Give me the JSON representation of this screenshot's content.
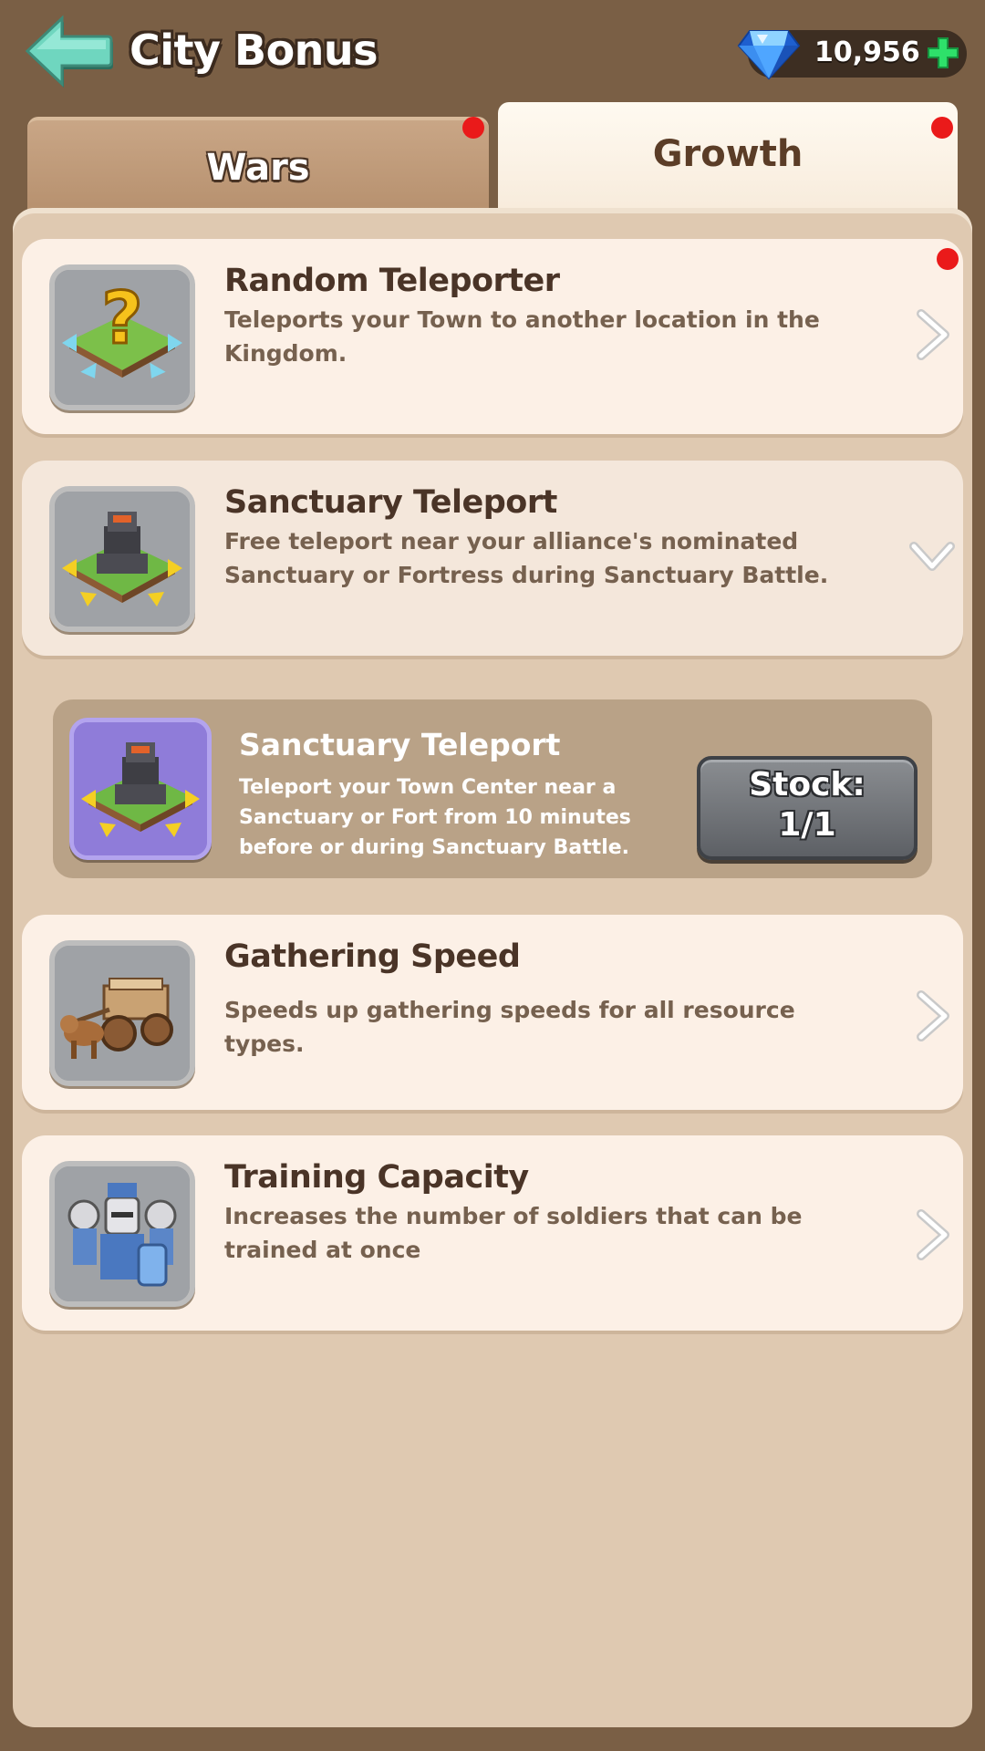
{
  "header": {
    "title": "City Bonus",
    "gems": "10,956"
  },
  "tabs": [
    {
      "label": "Wars",
      "selected": false,
      "has_notification": true
    },
    {
      "label": "Growth",
      "selected": true,
      "has_notification": true
    }
  ],
  "items": [
    {
      "title": "Random Teleporter",
      "description": "Teleports your Town to another location in the Kingdom.",
      "icon": "random-teleport-icon",
      "has_notification": true,
      "expanded": false
    },
    {
      "title": "Sanctuary Teleport",
      "description": "Free teleport near your alliance's nominated Sanctuary or Fortress during Sanctuary Battle.",
      "icon": "sanctuary-teleport-icon",
      "expanded": true,
      "sub_item": {
        "title": "Sanctuary Teleport",
        "description": "Teleport your Town Center near a Sanctuary or Fort from 10 minutes before or during Sanctuary Battle.",
        "stock_label": "Stock:",
        "stock_value": "1/1"
      }
    },
    {
      "title": "Gathering Speed",
      "description": "Speeds up gathering speeds for all resource types.",
      "icon": "cart-icon",
      "expanded": false
    },
    {
      "title": "Training Capacity",
      "description": "Increases the number of soldiers that can be trained at once",
      "icon": "soldiers-icon",
      "expanded": false
    }
  ],
  "colors": {
    "background": "#7a5f45",
    "panel": "#dfc9b1",
    "card": "#fcf0e6",
    "title_text": "#4a3427",
    "accent_red_dot": "#ea1a1a",
    "gem_plus": "#2ee06a"
  }
}
